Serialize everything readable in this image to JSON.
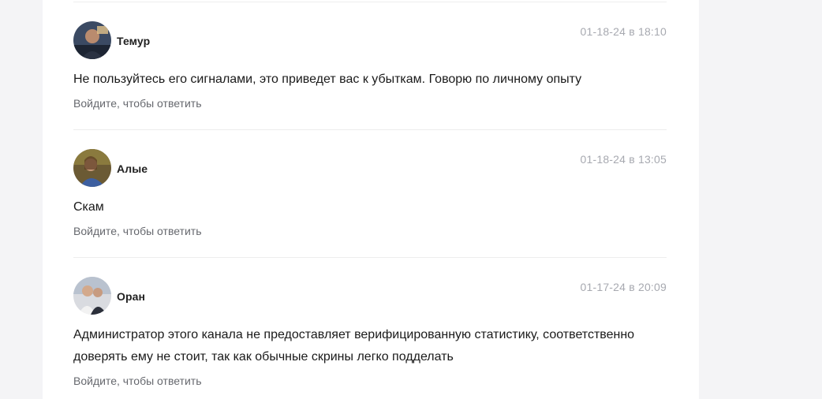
{
  "comments": [
    {
      "author": "Темур",
      "date": "01-18-24 в 18:10",
      "text": "Не пользуйтесь его сигналами, это приведет вас к убыткам. Говорю по личному опыту",
      "reply": "Войдите, чтобы ответить",
      "avatar_icon": "user-photo-avatar"
    },
    {
      "author": "Алые",
      "date": "01-18-24 в 13:05",
      "text": "Скам",
      "reply": "Войдите, чтобы ответить",
      "avatar_icon": "user-photo-avatar"
    },
    {
      "author": "Оран",
      "date": "01-17-24 в 20:09",
      "text": "Администратор этого канала не предоставляет верифицированную статистику, соответственно доверять ему не стоит, так как обычные скрины легко подделать",
      "reply": "Войдите, чтобы ответить",
      "avatar_icon": "user-photo-avatar"
    }
  ],
  "colors": {
    "page_background": "#f4f4f6",
    "panel_background": "#ffffff",
    "date_text": "#a7a9b0",
    "reply_text": "#66686e",
    "divider": "#ededed"
  }
}
